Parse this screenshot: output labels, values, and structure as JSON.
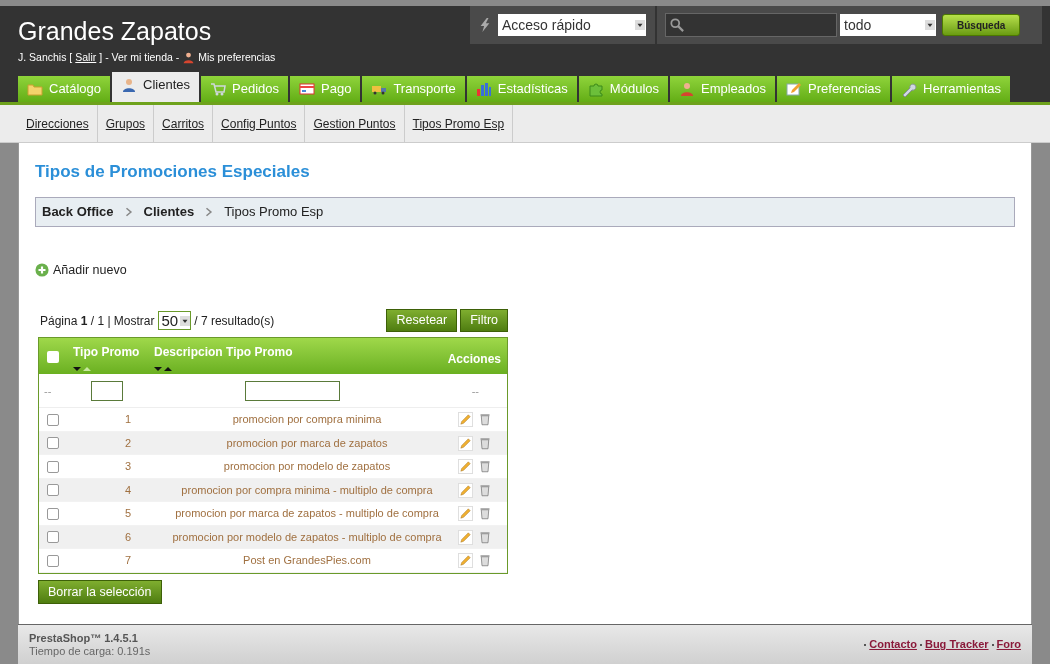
{
  "header": {
    "title": "Grandes Zapatos",
    "user_line": [
      {
        "kind": "text",
        "text": "J. Sanchis ["
      },
      {
        "kind": "link",
        "text": "Salir"
      },
      {
        "kind": "text",
        "text": "] - Ver mi tienda -"
      },
      {
        "kind": "prefs",
        "text": "Mis preferencias"
      }
    ],
    "quick_access": {
      "value": "Acceso rápido"
    },
    "search": {
      "scope": "todo",
      "button": "Búsqueda"
    }
  },
  "tabs": [
    {
      "label": "Catálogo",
      "selected": false
    },
    {
      "label": "Clientes",
      "selected": true
    },
    {
      "label": "Pedidos",
      "selected": false
    },
    {
      "label": "Pago",
      "selected": false
    },
    {
      "label": "Transporte",
      "selected": false
    },
    {
      "label": "Estadísticas",
      "selected": false
    },
    {
      "label": "Módulos",
      "selected": false
    },
    {
      "label": "Empleados",
      "selected": false
    },
    {
      "label": "Preferencias",
      "selected": false
    },
    {
      "label": "Herramientas",
      "selected": false
    }
  ],
  "subtabs": [
    "Direcciones",
    "Grupos",
    "Carritos",
    "Config Puntos",
    "Gestion Puntos",
    "Tipos Promo Esp"
  ],
  "page_title": "Tipos de Promociones Especiales",
  "breadcrumb": [
    "Back Office",
    "Clientes",
    "Tipos Promo Esp"
  ],
  "add_new": "Añadir nuevo",
  "pagination": {
    "prefix": "Página **1** / 1 | Mostrar",
    "per_page": "50",
    "suffix": "/ 7 resultado(s)"
  },
  "filter_buttons": [
    "Resetear",
    "Filtro"
  ],
  "table": {
    "select_all_checked": false,
    "columns": [
      {
        "label": "Tipo Promo",
        "sorted_ascending": true
      },
      {
        "label": "Descripcion Tipo Promo",
        "sorted_ascending": false
      },
      {
        "label": "Acciones"
      }
    ],
    "filter_row": [
      "--",
      "--"
    ],
    "rows": [
      {
        "id": "1",
        "description": "promocion por compra minima",
        "checked": false
      },
      {
        "id": "2",
        "description": "promocion por marca de zapatos",
        "checked": false
      },
      {
        "id": "3",
        "description": "promocion por modelo de zapatos",
        "checked": false
      },
      {
        "id": "4",
        "description": "promocion por compra minima - multiplo de compra",
        "checked": false
      },
      {
        "id": "5",
        "description": "promocion por marca de zapatos - multiplo de compra",
        "checked": false
      },
      {
        "id": "6",
        "description": "promocion por modelo de zapatos - multiplo de compra",
        "checked": false
      },
      {
        "id": "7",
        "description": "Post en GrandesPies.com",
        "checked": false
      }
    ]
  },
  "bulk_delete": "Borrar la selección",
  "footer": {
    "version": "PrestaShop™ 1.4.5.1",
    "load_time": "Tiempo de carga: 0.191s",
    "links": [
      "Contacto",
      "Bug Tracker",
      "Foro"
    ]
  }
}
